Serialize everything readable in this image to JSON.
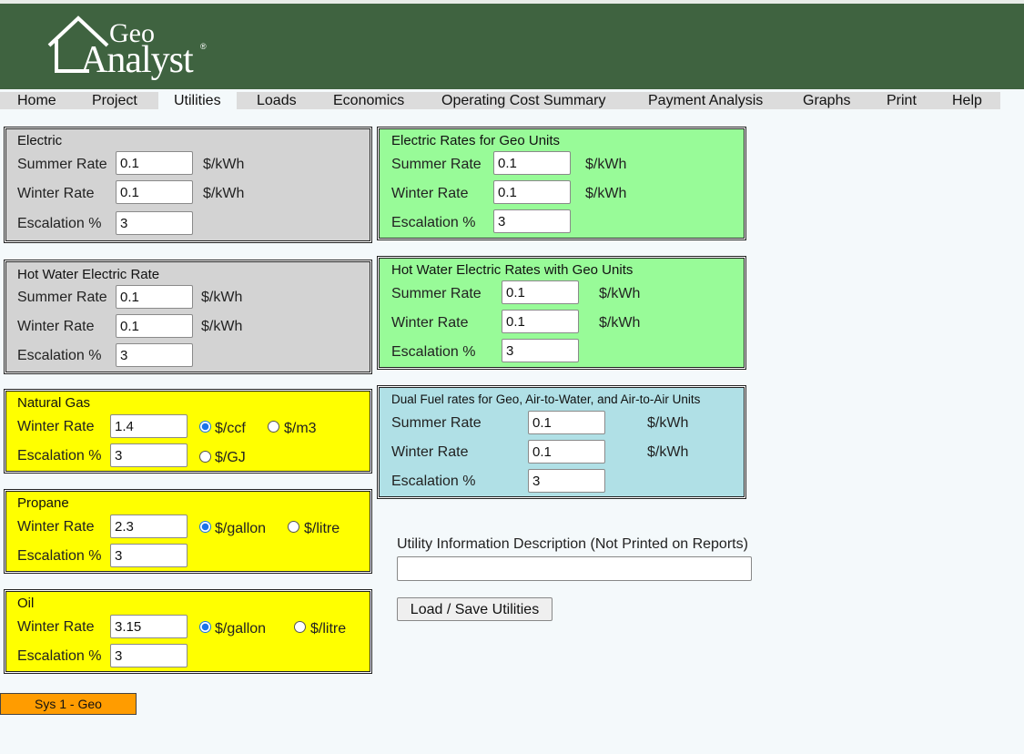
{
  "brand": {
    "geo": "Geo",
    "analyst": "Analyst",
    "reg": "®"
  },
  "nav": [
    "Home",
    "Project",
    "Utilities",
    "Loads",
    "Economics",
    "Operating Cost Summary",
    "Payment Analysis",
    "Graphs",
    "Print",
    "Help"
  ],
  "nav_active": "Utilities",
  "labels": {
    "summer": "Summer Rate",
    "winter": "Winter Rate",
    "escalation": "Escalation %"
  },
  "units": {
    "kwh": "$/kWh",
    "ccf": "$/ccf",
    "m3": "$/m3",
    "gj": "$/GJ",
    "gallon": "$/gallon",
    "litre": "$/litre"
  },
  "electric": {
    "title": "Electric",
    "summer": "0.1",
    "winter": "0.1",
    "escalation": "3"
  },
  "hot_water": {
    "title": "Hot Water Electric Rate",
    "summer": "0.1",
    "winter": "0.1",
    "escalation": "3"
  },
  "natural_gas": {
    "title": "Natural Gas",
    "winter": "1.4",
    "escalation": "3",
    "selected_unit": "$/ccf"
  },
  "propane": {
    "title": "Propane",
    "winter": "2.3",
    "escalation": "3",
    "selected_unit": "$/gallon"
  },
  "oil": {
    "title": "Oil",
    "winter": "3.15",
    "escalation": "3",
    "selected_unit": "$/gallon"
  },
  "geo_electric": {
    "title": "Electric Rates for Geo Units",
    "summer": "0.1",
    "winter": "0.1",
    "escalation": "3"
  },
  "geo_hot_water": {
    "title": "Hot Water Electric Rates with Geo Units",
    "summer": "0.1",
    "winter": "0.1",
    "escalation": "3"
  },
  "dual_fuel": {
    "title": "Dual Fuel rates for Geo, Air-to-Water, and Air-to-Air Units",
    "summer": "0.1",
    "winter": "0.1",
    "escalation": "3"
  },
  "description": {
    "label": "Utility Information Description (Not Printed on Reports)",
    "value": ""
  },
  "load_save_label": "Load / Save Utilities",
  "system_button": "Sys 1 - Geo",
  "colors": {
    "header": "#3f6340",
    "grey_panel": "#d3d3d3",
    "green_panel": "#98fb98",
    "yellow_panel": "#ffff00",
    "cyan_panel": "#b0e0e6",
    "system_button": "#ff9c00"
  }
}
